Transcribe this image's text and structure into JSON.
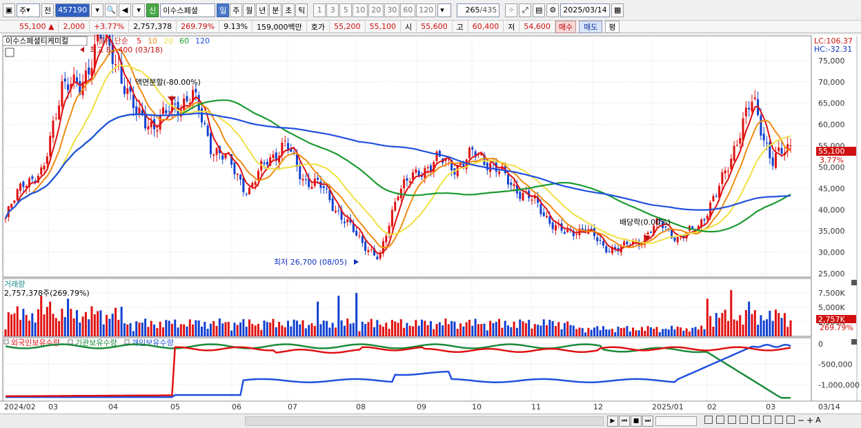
{
  "toolbar": {
    "market_sel": "주",
    "prev_label": "전",
    "stock_code": "457190",
    "new_badge": "신",
    "stock_name": "이수스페셜",
    "periods": [
      "일",
      "주",
      "월",
      "년",
      "분",
      "초",
      "틱"
    ],
    "active_period": "일",
    "intervals": [
      "1",
      "3",
      "5",
      "10",
      "20",
      "30",
      "60",
      "120"
    ],
    "count": "265",
    "total": "/435",
    "date": "2025/03/14"
  },
  "quote": {
    "price": "55,100",
    "change": "2,000",
    "change_pct": "+3.77%",
    "volume": "2,757,378",
    "vol_ratio": "269.79%",
    "turnover": "9.13%",
    "amount": "159,000백만",
    "bid_label": "호가",
    "ask": "55,200",
    "bid": "55,100",
    "open_label": "시",
    "open": "55,600",
    "high_label": "고",
    "high": "60,400",
    "low_label": "저",
    "low": "54,600",
    "buy": "매수",
    "sell": "매도",
    "eval": "평"
  },
  "price_panel": {
    "stock_label": "이수스페셜티케미컬",
    "legend_title": "종가 단순",
    "ma_labels": [
      "5",
      "10",
      "20",
      "60",
      "120"
    ],
    "ma_colors": [
      "#e01010",
      "#f08c10",
      "#f0e040",
      "#1a9a30",
      "#2050e0"
    ],
    "lc": "LC:106.37",
    "hc": "HC:-32.31",
    "y_ticks": [
      "75,000",
      "70,000",
      "65,000",
      "60,000",
      "55,000",
      "50,000",
      "45,000",
      "40,000",
      "35,000",
      "30,000",
      "25,000"
    ],
    "last_price_tag": "55,100",
    "last_pct_tag": "3.77%",
    "annot_high": "최고 81,400 (03/18)",
    "annot_split": "액면분할(-80.00%)",
    "annot_low": "최저 26,700 (08/05)",
    "annot_div": "배당락(0.00%)"
  },
  "volume_panel": {
    "title": "거래량",
    "value": "2,757,378주(269.79%)",
    "y_ticks": [
      "7,500K",
      "5,000K",
      "2,500K"
    ],
    "last_tag": "2,757K",
    "last_pct_tag": "269.79%"
  },
  "holding_panel": {
    "legend": [
      "외국인보유수량",
      "기관보유수량",
      "개인보유수량"
    ],
    "colors": [
      "#e01010",
      "#1a8a3a",
      "#2050e0"
    ],
    "y_ticks": [
      "0",
      "-500,000",
      "-1,000,000"
    ]
  },
  "x_axis": {
    "labels": [
      "2024/02",
      "03",
      "04",
      "05",
      "06",
      "07",
      "08",
      "09",
      "10",
      "11",
      "12",
      "2025/01",
      "02",
      "03"
    ],
    "right_label": "03/14"
  },
  "chart_data": {
    "type": "line",
    "x_range": [
      "2024/02",
      "2025/03/14"
    ],
    "ylim": [
      25000,
      80000
    ],
    "series": [
      {
        "name": "종가",
        "values": [
          38000,
          47000,
          48000,
          70000,
          68000,
          81400,
          74000,
          62000,
          60000,
          64000,
          67000,
          55000,
          51000,
          44000,
          52000,
          55000,
          47000,
          45000,
          38000,
          33000,
          28000,
          45000,
          48000,
          52000,
          50000,
          53000,
          51000,
          46000,
          43000,
          38000,
          34000,
          36000,
          31000,
          31000,
          33000,
          37000,
          33000,
          36000,
          43000,
          55000,
          66000,
          51000,
          55100
        ]
      }
    ]
  }
}
